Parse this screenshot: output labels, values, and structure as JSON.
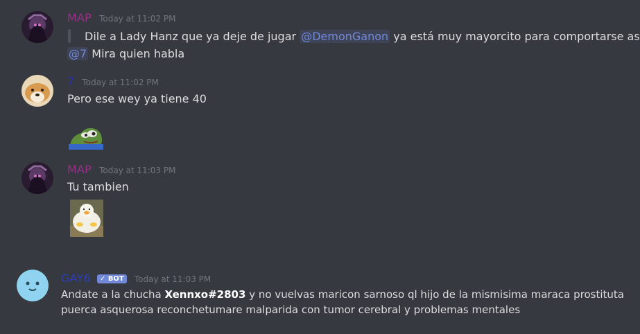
{
  "colors": {
    "map_name": "#9b2f8a",
    "seven_name": "#2a2fb5",
    "gay6_name": "#2e3fb5",
    "mention": "#7289da",
    "bot_badge": "#7289da",
    "timestamp": "#72767d"
  },
  "messages": [
    {
      "author": "MAP",
      "timestamp": "Today at 11:02 PM",
      "quote": {
        "pre": "Dile a Lady Hanz que ya deje de jugar",
        "mention": "@DemonGanon",
        "post": "ya está muy mayorcito para comportarse así"
      },
      "reply": {
        "mention": "@7",
        "text": "Mira quien habla"
      }
    },
    {
      "author": "7",
      "timestamp": "Today at 11:02 PM",
      "text": "Pero ese wey ya tiene 40",
      "emoji": "pepe-frog-emoji"
    },
    {
      "author": "MAP",
      "timestamp": "Today at 11:03 PM",
      "text": "Tu tambien",
      "image": "duck-image"
    },
    {
      "author": "GAY6",
      "bot_label": "✓ BOT",
      "timestamp": "Today at 11:03 PM",
      "text_pre": "Andate a la chucha",
      "bold": "Xennxo#2803",
      "text_post": "y no vuelvas maricon sarnoso ql hijo de la mismisima maraca prostituta puerca asquerosa reconchetumare malparida con tumor cerebral y problemas mentales"
    }
  ]
}
